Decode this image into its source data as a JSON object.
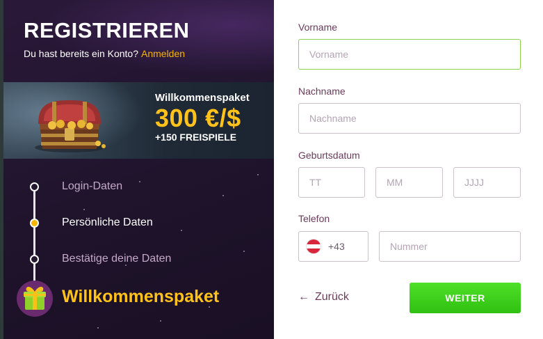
{
  "header": {
    "title": "REGISTRIEREN",
    "subtitle": "Du hast bereits ein Konto?",
    "login_link": "Anmelden"
  },
  "banner": {
    "kicker": "Willkommenspaket",
    "amount": "300 €/$",
    "spins": "+150 FREISPIELE"
  },
  "steps": [
    {
      "label": "Login-Daten",
      "state": "done"
    },
    {
      "label": "Persönliche Daten",
      "state": "active"
    },
    {
      "label": "Bestätige deine Daten",
      "state": "pending"
    }
  ],
  "final_step": {
    "label": "Willkommenspaket"
  },
  "form": {
    "first_name": {
      "label": "Vorname",
      "placeholder": "Vorname",
      "value": ""
    },
    "last_name": {
      "label": "Nachname",
      "placeholder": "Nachname",
      "value": ""
    },
    "birthdate": {
      "label": "Geburtsdatum",
      "day_placeholder": "TT",
      "month_placeholder": "MM",
      "year_placeholder": "JJJJ"
    },
    "phone": {
      "label": "Telefon",
      "country_prefix": "+43",
      "placeholder": "Nummer"
    }
  },
  "actions": {
    "back_label": "Zurück",
    "next_label": "WEITER"
  },
  "colors": {
    "accent_yellow": "#ffc21a",
    "button_green": "#3fd01c",
    "panel_bg": "#231631",
    "label_text": "#6b3a5a",
    "focus_border": "#8ccf4d"
  },
  "icons": {
    "back": "arrow-left-icon",
    "flag": "austria-flag-icon",
    "gift": "gift-icon",
    "chest": "treasure-chest-icon"
  }
}
